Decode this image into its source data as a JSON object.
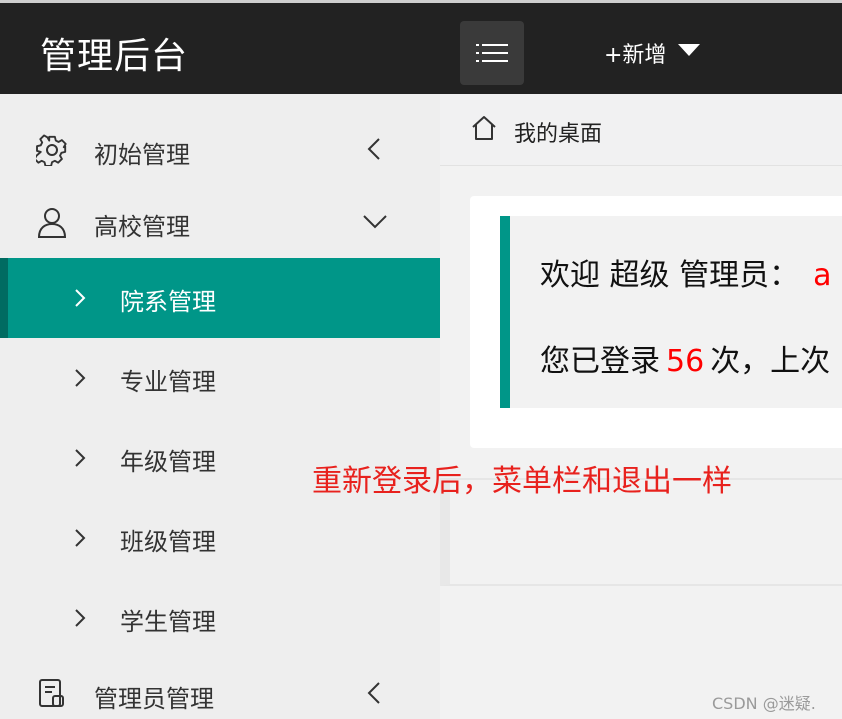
{
  "header": {
    "logo": "管理后台",
    "add_menu_label": "+新增"
  },
  "sidebar": {
    "items": [
      {
        "label": "初始管理",
        "icon": "gear-icon",
        "state": "collapsed"
      },
      {
        "label": "高校管理",
        "icon": "user-icon",
        "state": "expanded",
        "children": [
          {
            "label": "院系管理",
            "active": true
          },
          {
            "label": "专业管理"
          },
          {
            "label": "年级管理"
          },
          {
            "label": "班级管理"
          },
          {
            "label": "学生管理"
          }
        ]
      },
      {
        "label": "管理员管理",
        "icon": "admin-doc-icon",
        "state": "collapsed"
      }
    ]
  },
  "breadcrumb": {
    "label": "我的桌面",
    "icon": "home-icon"
  },
  "welcome": {
    "greeting": "欢迎 超级 管理员：",
    "username_partial": "a",
    "login_prefix": "您已登录",
    "login_count": "56",
    "login_suffix": "次，上次"
  },
  "annotation": "重新登录后，菜单栏和退出一样",
  "watermark": "CSDN @迷疑.",
  "colors": {
    "topbar": "#222222",
    "accent": "#009688",
    "highlight": "#ff0000"
  }
}
